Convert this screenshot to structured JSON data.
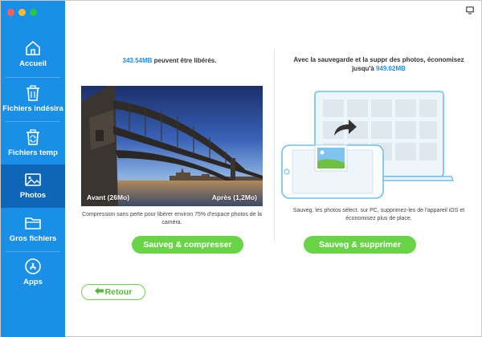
{
  "sidebar": {
    "items": [
      {
        "label": "Accueil",
        "icon": "home-icon"
      },
      {
        "label": "Fichiers indésira",
        "icon": "trash-icon"
      },
      {
        "label": "Fichiers temp",
        "icon": "temp-bin-icon"
      },
      {
        "label": "Photos",
        "icon": "photo-icon",
        "active": true
      },
      {
        "label": "Gros fichiers",
        "icon": "folder-icon"
      },
      {
        "label": "Apps",
        "icon": "app-store-icon"
      }
    ]
  },
  "left_panel": {
    "size_value": "343.54MB",
    "heading_rest": " peuvent être libérés.",
    "caption_before": "Avant (26Mo)",
    "caption_after": "Après (1,2Mo)",
    "description": "Compression sans perte pour libérer environ 75% d'espace photos de la caméra.",
    "button_label": "Sauveg & compresser"
  },
  "right_panel": {
    "heading_line1": "Avec la sauvegarde et la suppr des photos, économisez",
    "heading_prefix": "jusqu'à ",
    "heading_value": "949.02MB",
    "description": "Sauveg. les photos sélect. sur PC, supprimez-les de l'appareil iOS et économisez plus de place.",
    "button_label": "Sauveg & supprimer"
  },
  "back_button": {
    "label": "Retour"
  },
  "colors": {
    "sidebar": "#1a8fe8",
    "sidebar_active": "#0d66b8",
    "accent_blue": "#1a8fe8",
    "green": "#6ad447"
  }
}
